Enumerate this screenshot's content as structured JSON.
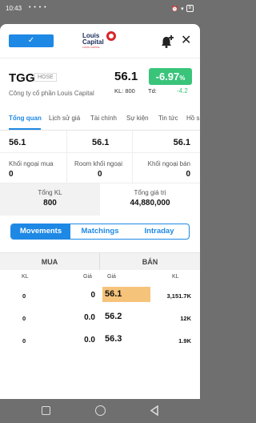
{
  "status_bar": {
    "time": "10:43",
    "dots": "• • • •",
    "battery": "8"
  },
  "header": {
    "logo_line1": "Louis",
    "logo_line2": "Capital",
    "logo_tag": "LOUIS CAPITAL"
  },
  "quote": {
    "symbol": "TGG",
    "exchange": "HOSE",
    "company": "Công ty cổ phần Louis Capital",
    "price": "56.1",
    "change_pct": "-6.97",
    "pct_sign": "%",
    "kl": "KL: 800",
    "td_label": "Td:",
    "td_value": "-4.2"
  },
  "tabs": [
    "Tổng quan",
    "Lịch sử giá",
    "Tài chính",
    "Sự kiện",
    "Tin tức",
    "Hồ s"
  ],
  "prices_row": [
    "56.1",
    "56.1",
    "56.1"
  ],
  "foreign": [
    {
      "label": "Khối ngoại mua",
      "value": "0"
    },
    {
      "label": "Room khối ngoại",
      "value": "0"
    },
    {
      "label": "Khối ngoại bán",
      "value": "0"
    }
  ],
  "totals": {
    "kl_label": "Tổng KL",
    "kl_value": "800",
    "gt_label": "Tổng giá trị",
    "gt_value": "44,880,000"
  },
  "segments": [
    "Movements",
    "Matchings",
    "Intraday"
  ],
  "orderbook": {
    "buy_header": "MUA",
    "sell_header": "BÁN",
    "sub": {
      "buy_kl": "KL",
      "buy_gia": "Giá",
      "sell_gia": "Giá",
      "sell_kl": "KL"
    },
    "rows": [
      {
        "buy_kl": "0",
        "buy_gia": "0",
        "sell_gia": "56.1",
        "sell_kl": "3,151.7K"
      },
      {
        "buy_kl": "0",
        "buy_gia": "0.0",
        "sell_gia": "56.2",
        "sell_kl": "12K"
      },
      {
        "buy_kl": "0",
        "buy_gia": "0.0",
        "sell_gia": "56.3",
        "sell_kl": "1.9K"
      }
    ]
  },
  "colors": {
    "accent": "#1e88e5",
    "up": "#39c47a",
    "highlight": "#f6c37b",
    "brand_red": "#d9252a"
  }
}
